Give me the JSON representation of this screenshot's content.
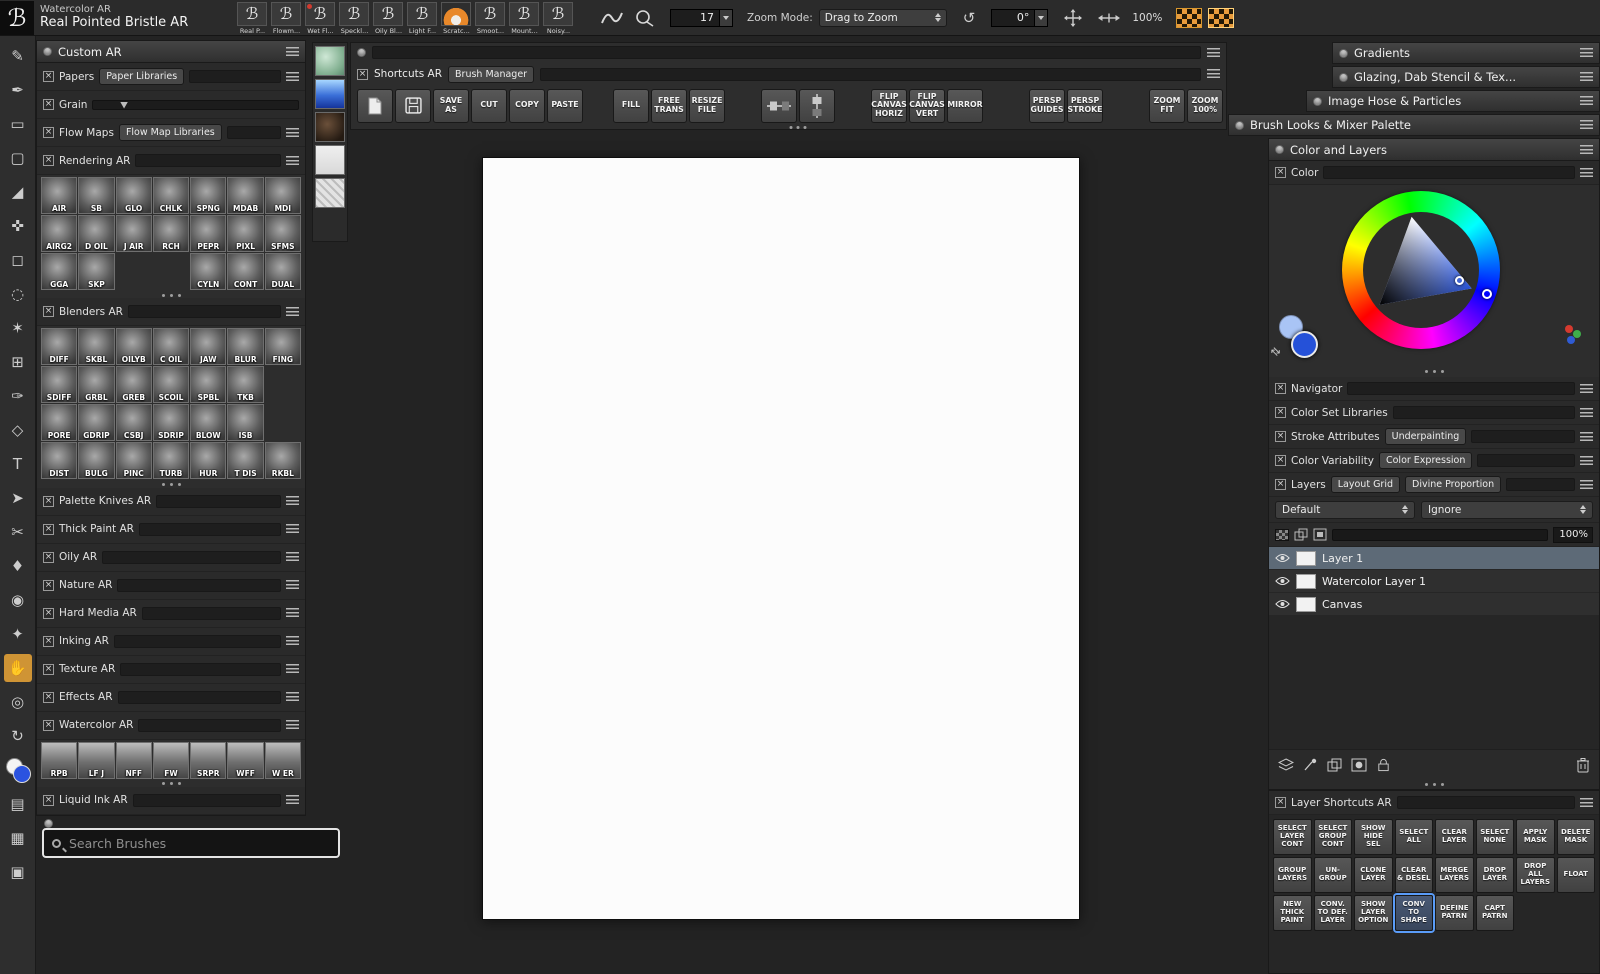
{
  "colors": {
    "accent_orange": "#cf9435",
    "selection_blue": "#5a9cf8",
    "selected_layer_bg": "#5d6a77",
    "main_color_swatch": "#2551d8",
    "secondary_color_swatch": "#a9c4f5"
  },
  "topbar": {
    "workspace": "Watercolor AR",
    "brush_name": "Real Pointed Bristle AR",
    "variants": [
      {
        "label": "Real P..."
      },
      {
        "label": "Flowm..."
      },
      {
        "label": "Wet Fl...",
        "cls": "reddot"
      },
      {
        "label": "Speckl..."
      },
      {
        "label": "Oily Bl..."
      },
      {
        "label": "Light F..."
      },
      {
        "label": "Scratc...",
        "cls": "cone"
      },
      {
        "label": "Smoot..."
      },
      {
        "label": "Mount..."
      },
      {
        "label": "Noisy..."
      }
    ],
    "size_value": "17",
    "zoom_mode_label": "Zoom Mode:",
    "zoom_mode_value": "Drag to Zoom",
    "rotate_icon": "↺",
    "rotation_value": "0°",
    "zoom_percent": "100%"
  },
  "tools": [
    {
      "name": "brush-tool",
      "g": "✎"
    },
    {
      "name": "airbrush-tool",
      "g": "✒"
    },
    {
      "name": "eraser-tool",
      "g": "▭"
    },
    {
      "name": "stamp-tool",
      "g": "▢"
    },
    {
      "name": "wedge-eraser-tool",
      "g": "◢"
    },
    {
      "name": "layer-mover-tool",
      "g": "✜"
    },
    {
      "name": "rect-select-tool",
      "g": "◻"
    },
    {
      "name": "lasso-tool",
      "g": "◌"
    },
    {
      "name": "magic-wand-tool",
      "g": "✶"
    },
    {
      "name": "crop-tool",
      "g": "⊞"
    },
    {
      "name": "pen-tool",
      "g": "✑"
    },
    {
      "name": "shape-tool",
      "g": "◇"
    },
    {
      "name": "text-tool",
      "g": "T"
    },
    {
      "name": "shape-select-tool",
      "g": "➤"
    },
    {
      "name": "scissors-tool",
      "g": "✂"
    },
    {
      "name": "dropper-tool",
      "g": "♦"
    },
    {
      "name": "paint-bucket-tool",
      "g": "◉"
    },
    {
      "name": "divine-proportion-tool",
      "g": "✦"
    },
    {
      "name": "hand-tool",
      "g": "✋",
      "cls": "active"
    },
    {
      "name": "magnifier-tool",
      "g": "◎"
    },
    {
      "name": "rotate-page-tool",
      "g": "↻"
    },
    {
      "name": "main-color-swatch",
      "g": "",
      "cls": "swatch"
    },
    {
      "name": "paper-selector",
      "g": "▤"
    },
    {
      "name": "gradient-selector",
      "g": "▦"
    },
    {
      "name": "pattern-selector",
      "g": "▣"
    }
  ],
  "custom_panel": {
    "title": "Custom AR",
    "papers_label": "Papers",
    "papers_button": "Paper Libraries",
    "grain_label": "Grain",
    "flowmaps_label": "Flow Maps",
    "flowmaps_button": "Flow Map Libraries",
    "rendering_label": "Rendering AR",
    "grid1": [
      {
        "l": "AIR"
      },
      {
        "l": "SB"
      },
      {
        "l": "GLO"
      },
      {
        "l": "CHLK"
      },
      {
        "l": "SPNG"
      },
      {
        "l": "MDAB"
      },
      {
        "l": "MDI"
      },
      {
        "l": "AIRG2"
      },
      {
        "l": "D OIL"
      },
      {
        "l": "J AIR"
      },
      {
        "l": "RCH"
      },
      {
        "l": "PEPR"
      },
      {
        "l": "PIXL"
      },
      {
        "l": "SFMS"
      },
      {
        "l": "GGA"
      },
      {
        "l": "SKP"
      },
      {
        "l": "",
        "cls": "blank"
      },
      {
        "l": "",
        "cls": "blank"
      },
      {
        "l": "CYLN"
      },
      {
        "l": "CONT"
      },
      {
        "l": "DUAL"
      }
    ],
    "blenders_label": "Blenders AR",
    "grid2": [
      {
        "l": "DIFF"
      },
      {
        "l": "SKBL"
      },
      {
        "l": "OILYB"
      },
      {
        "l": "C OIL"
      },
      {
        "l": "JAW"
      },
      {
        "l": "BLUR"
      },
      {
        "l": "FING"
      },
      {
        "l": "SDIFF"
      },
      {
        "l": "GRBL"
      },
      {
        "l": "GREB"
      },
      {
        "l": "SCOIL"
      },
      {
        "l": "SPBL"
      },
      {
        "l": "TKB"
      },
      {
        "l": "",
        "cls": "blank"
      },
      {
        "l": "PORE"
      },
      {
        "l": "GDRIP"
      },
      {
        "l": "CSBJ"
      },
      {
        "l": "SDRIP"
      },
      {
        "l": "BLOW"
      },
      {
        "l": "ISB"
      },
      {
        "l": "",
        "cls": "blank"
      },
      {
        "l": "DIST"
      },
      {
        "l": "BULG"
      },
      {
        "l": "PINC"
      },
      {
        "l": "TURB"
      },
      {
        "l": "HUR"
      },
      {
        "l": "T DIS"
      },
      {
        "l": "RKBL"
      }
    ],
    "sections": [
      "Palette Knives AR",
      "Thick Paint AR",
      "Oily AR",
      "Nature AR",
      "Hard Media AR",
      "Inking AR",
      "Texture AR",
      "Effects AR"
    ],
    "watercolor_label": "Watercolor AR",
    "grid3": [
      {
        "l": "RPB"
      },
      {
        "l": "LF J"
      },
      {
        "l": "NFF"
      },
      {
        "l": "FW"
      },
      {
        "l": "SRPR"
      },
      {
        "l": "WFF"
      },
      {
        "l": "W ER"
      }
    ],
    "liquid_label": "Liquid Ink AR",
    "search_placeholder": "Search Brushes"
  },
  "shortcuts_panel": {
    "tab_checkbox": "Shortcuts AR",
    "tab_button": "Brush Manager",
    "save_as": "SAVE\nAS",
    "cut": "CUT",
    "copy": "COPY",
    "paste": "PASTE",
    "fill": "FILL",
    "free_trans": "FREE\nTRANS",
    "resize_file": "RESIZE\nFILE",
    "flip_h": "FLIP\nCANVAS\nHORIZ",
    "flip_v": "FLIP\nCANVAS\nVERT",
    "mirror": "MIRROR",
    "persp_guides": "PERSP\nGUIDES",
    "persp_stroke": "PERSP\nSTROKE",
    "zoom_fit": "ZOOM\nFIT",
    "zoom_100": "ZOOM\n100%"
  },
  "right_headers": [
    {
      "title": "Gradients"
    },
    {
      "title": "Glazing, Dab Stencil & Tex..."
    },
    {
      "title": "Image Hose & Particles"
    },
    {
      "title": "Brush Looks & Mixer Palette"
    }
  ],
  "color_layers": {
    "title": "Color and Layers",
    "color_label": "Color",
    "navigator_label": "Navigator",
    "color_set_label": "Color Set Libraries",
    "stroke_attributes_label": "Stroke Attributes",
    "underpainting_button": "Underpainting",
    "color_variability_label": "Color Variability",
    "color_expression_button": "Color Expression",
    "layers_label": "Layers",
    "layout_grid_button": "Layout Grid",
    "divine_proportion_button": "Divine Proportion",
    "blend_mode_value": "Default",
    "ignore_value": "Ignore",
    "opacity_value": "100%",
    "layers": [
      {
        "name": "Layer 1",
        "cls": "selected"
      },
      {
        "name": "Watercolor Layer 1"
      },
      {
        "name": "Canvas"
      }
    ]
  },
  "layer_shortcuts": {
    "title": "Layer Shortcuts AR",
    "buttons": [
      {
        "label": "SELECT\nLAYER\nCONT"
      },
      {
        "label": "SELECT\nGROUP\nCONT"
      },
      {
        "label": "SHOW\nHIDE\nSEL"
      },
      {
        "label": "SELECT\nALL"
      },
      {
        "label": "CLEAR\nLAYER"
      },
      {
        "label": "SELECT\nNONE"
      },
      {
        "label": "APPLY\nMASK"
      },
      {
        "label": "DELETE\nMASK"
      },
      {
        "label": "GROUP\nLAYERS"
      },
      {
        "label": "UN-\nGROUP"
      },
      {
        "label": "CLONE\nLAYER"
      },
      {
        "label": "CLEAR\n& DESEL"
      },
      {
        "label": "MERGE\nLAYERS"
      },
      {
        "label": "DROP\nLAYER"
      },
      {
        "label": "DROP\nALL\nLAYERS"
      },
      {
        "label": "FLOAT"
      },
      {
        "label": "NEW\nTHICK\nPAINT"
      },
      {
        "label": "CONV.\nTO DEF.\nLAYER"
      },
      {
        "label": "SHOW\nLAYER\nOPTION"
      },
      {
        "label": "CONV\nTO\nSHAPE",
        "cls": "active"
      },
      {
        "label": "DEFINE\nPATRN"
      },
      {
        "label": "CAPT\nPATRN"
      },
      {
        "label": "",
        "cls": "blank"
      },
      {
        "label": "",
        "cls": "blank"
      }
    ]
  }
}
